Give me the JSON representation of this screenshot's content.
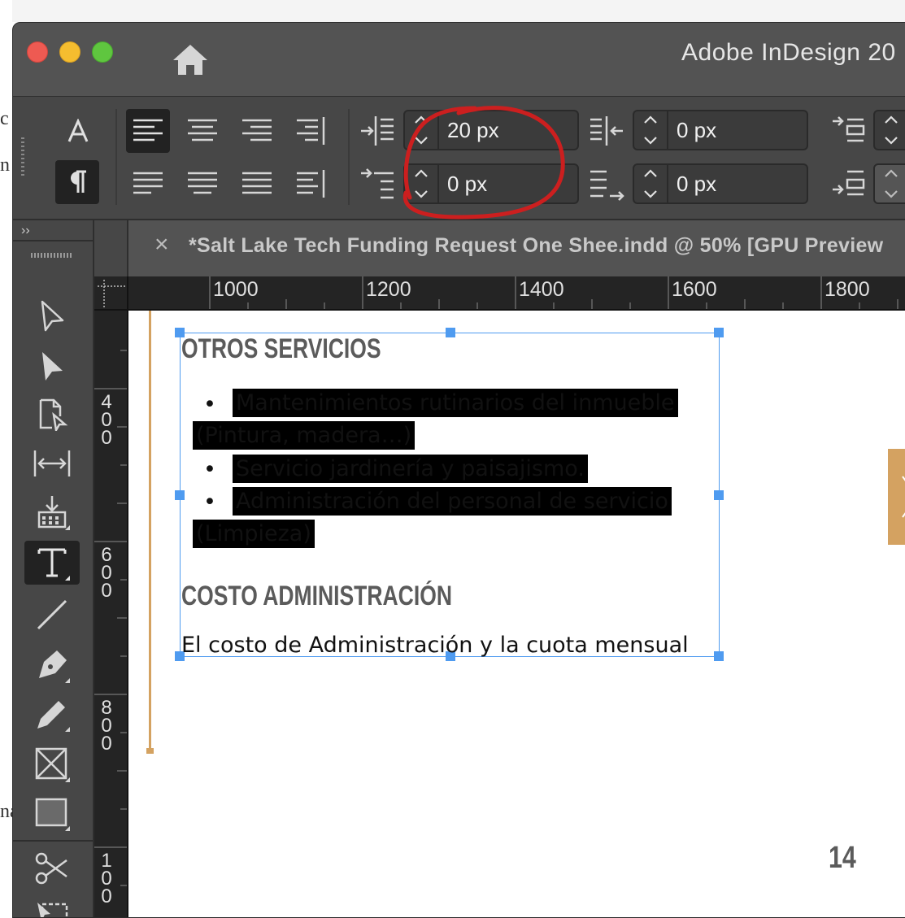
{
  "window": {
    "title": "Adobe InDesign 20"
  },
  "background": {
    "fragments": [
      "c",
      "n",
      "na"
    ]
  },
  "control_panel": {
    "left_indent": "20 px",
    "first_line_indent": "0 px",
    "right_indent": "0 px",
    "last_line_indent": "0 px"
  },
  "document_tab": {
    "close_glyph": "×",
    "title": "*Salt Lake Tech Funding Request One Shee.indd @ 50% [GPU Preview"
  },
  "toolbox": {
    "collapse_glyph": "››"
  },
  "rulers": {
    "horizontal": [
      "1000",
      "1200",
      "1400",
      "1600",
      "1800"
    ],
    "vertical": [
      "400",
      "600",
      "800",
      "100"
    ]
  },
  "page": {
    "heading_other_services": "OTROS SERVICIOS",
    "bullet_glyph": "•",
    "bullets": [
      {
        "line1": "Mantenimientos rutinarios del inmueble",
        "line2": "(Pintura, madera…)"
      },
      {
        "line1": "Servicio jardinería y paisajismo.",
        "line2": ""
      },
      {
        "line1": "Administración del personal de servicio",
        "line2": "(Limpieza)"
      }
    ],
    "heading_admin_cost": "COSTO ADMINISTRACIÓN",
    "body_line": "El costo de Administración y la cuota mensual",
    "page_number": "14"
  },
  "colors": {
    "selection": "#4f9bf0",
    "annotation_circle": "#cc1f1f",
    "page_tab": "#d4a261",
    "margin_guide": "#d4a261"
  }
}
